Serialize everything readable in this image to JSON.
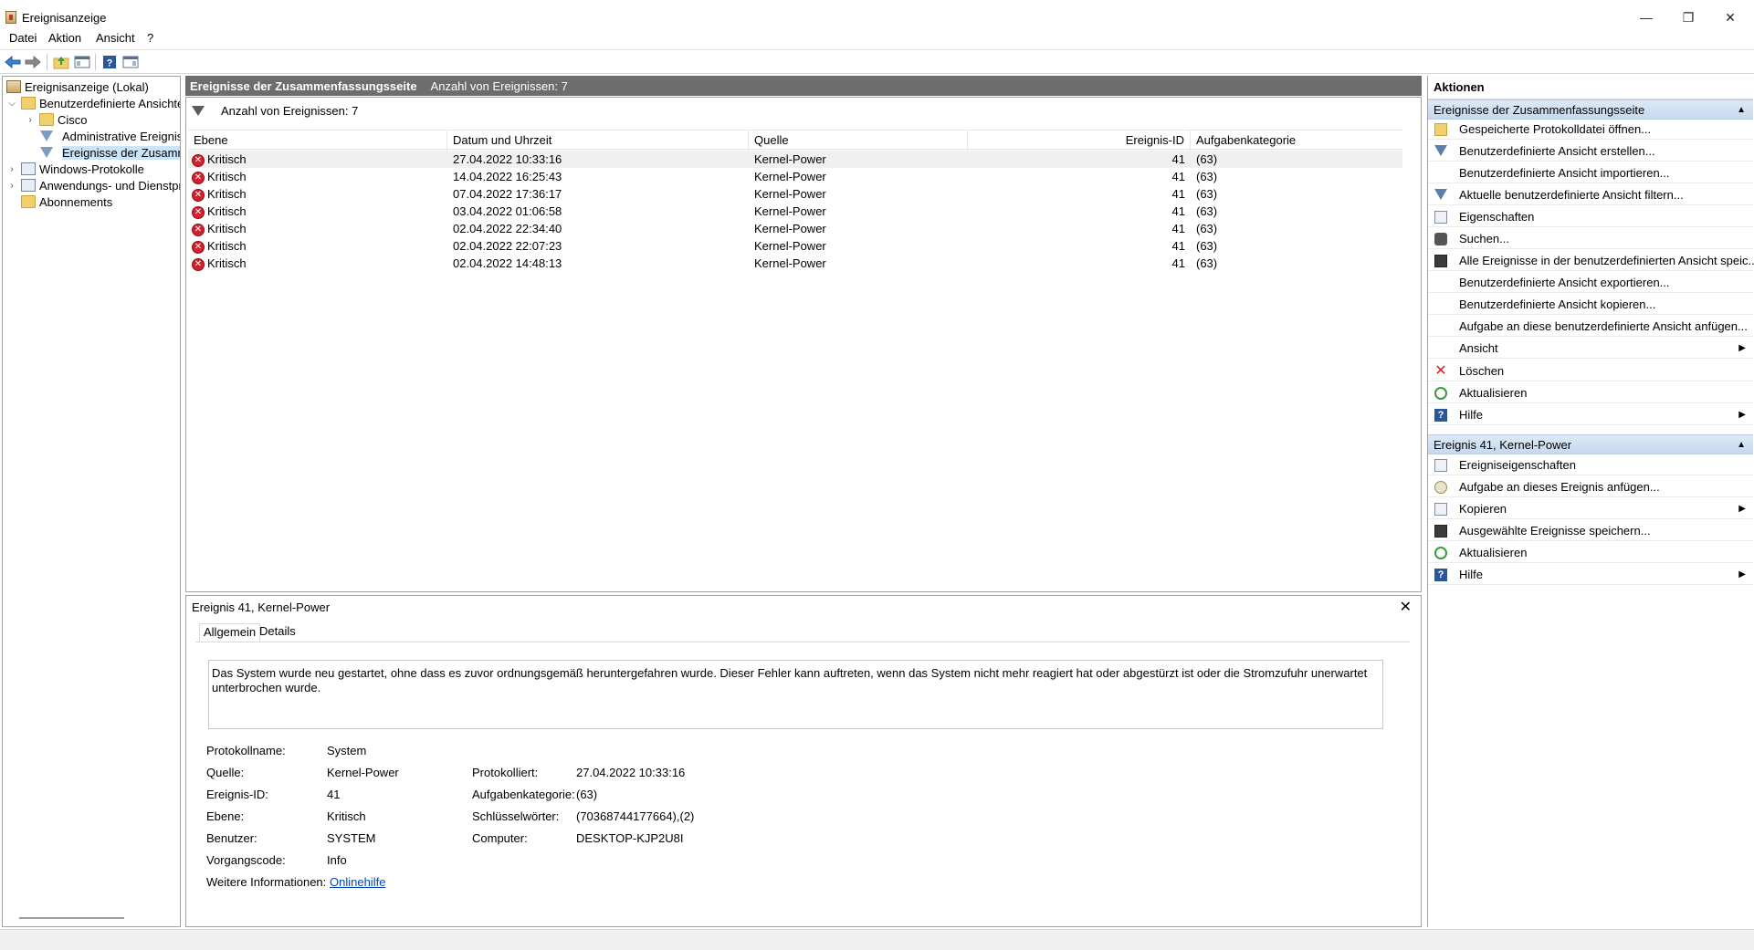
{
  "window": {
    "title": "Ereignisanzeige",
    "minimize": "—",
    "restore": "❐",
    "close": "✕"
  },
  "menu": [
    "Datei",
    "Aktion",
    "Ansicht",
    "?"
  ],
  "tree": {
    "root": "Ereignisanzeige (Lokal)",
    "custom_views": "Benutzerdefinierte Ansichten",
    "cisco": "Cisco",
    "admin_events": "Administrative Ereignisse",
    "summary_events": "Ereignisse der Zusammenfassungsseite",
    "windows_logs": "Windows-Protokolle",
    "app_service_logs": "Anwendungs- und Dienstprotokolle",
    "subscriptions": "Abonnements"
  },
  "center": {
    "header_title": "Ereignisse der Zusammenfassungsseite",
    "header_count": "Anzahl von Ereignissen: 7",
    "filter_count": "Anzahl von Ereignissen: 7",
    "columns": {
      "level": "Ebene",
      "datetime": "Datum und Uhrzeit",
      "source": "Quelle",
      "event_id": "Ereignis-ID",
      "task_category": "Aufgabenkategorie"
    },
    "rows": [
      {
        "level": "Kritisch",
        "datetime": "27.04.2022 10:33:16",
        "source": "Kernel-Power",
        "event_id": "41",
        "task_category": "(63)"
      },
      {
        "level": "Kritisch",
        "datetime": "14.04.2022 16:25:43",
        "source": "Kernel-Power",
        "event_id": "41",
        "task_category": "(63)"
      },
      {
        "level": "Kritisch",
        "datetime": "07.04.2022 17:36:17",
        "source": "Kernel-Power",
        "event_id": "41",
        "task_category": "(63)"
      },
      {
        "level": "Kritisch",
        "datetime": "03.04.2022 01:06:58",
        "source": "Kernel-Power",
        "event_id": "41",
        "task_category": "(63)"
      },
      {
        "level": "Kritisch",
        "datetime": "02.04.2022 22:34:40",
        "source": "Kernel-Power",
        "event_id": "41",
        "task_category": "(63)"
      },
      {
        "level": "Kritisch",
        "datetime": "02.04.2022 22:07:23",
        "source": "Kernel-Power",
        "event_id": "41",
        "task_category": "(63)"
      },
      {
        "level": "Kritisch",
        "datetime": "02.04.2022 14:48:13",
        "source": "Kernel-Power",
        "event_id": "41",
        "task_category": "(63)"
      }
    ]
  },
  "detail": {
    "title": "Ereignis 41, Kernel-Power",
    "close": "✕",
    "tabs": [
      "Allgemein",
      "Details"
    ],
    "description": "Das System wurde neu gestartet, ohne dass es zuvor ordnungsgemäß heruntergefahren wurde. Dieser Fehler kann auftreten, wenn das System nicht mehr reagiert hat oder abgestürzt ist oder die Stromzufuhr unerwartet unterbrochen wurde.",
    "log_name_label": "Protokollname:",
    "log_name": "System",
    "source_label": "Quelle:",
    "source": "Kernel-Power",
    "logged_label": "Protokolliert:",
    "logged": "27.04.2022 10:33:16",
    "event_id_label": "Ereignis-ID:",
    "event_id": "41",
    "task_category_label": "Aufgabenkategorie:",
    "task_category": "(63)",
    "level_label": "Ebene:",
    "level": "Kritisch",
    "keywords_label": "Schlüsselwörter:",
    "keywords": "(70368744177664),(2)",
    "user_label": "Benutzer:",
    "user": "SYSTEM",
    "computer_label": "Computer:",
    "computer": "DESKTOP-KJP2U8I",
    "opcode_label": "Vorgangscode:",
    "opcode": "Info",
    "more_info_label": "Weitere Informationen:",
    "more_info_link": "Onlinehilfe"
  },
  "actions": {
    "title": "Aktionen",
    "section1": "Ereignisse der Zusammenfassungsseite",
    "items1": [
      "Gespeicherte Protokolldatei öffnen...",
      "Benutzerdefinierte Ansicht erstellen...",
      "Benutzerdefinierte Ansicht importieren...",
      "Aktuelle benutzerdefinierte Ansicht filtern...",
      "Eigenschaften",
      "Suchen...",
      "Alle Ereignisse in der benutzerdefinierten Ansicht speic...",
      "Benutzerdefinierte Ansicht exportieren...",
      "Benutzerdefinierte Ansicht kopieren...",
      "Aufgabe an diese benutzerdefinierte Ansicht anfügen...",
      "Ansicht",
      "Löschen",
      "Aktualisieren",
      "Hilfe"
    ],
    "section2": "Ereignis 41, Kernel-Power",
    "items2": [
      "Ereigniseigenschaften",
      "Aufgabe an dieses Ereignis anfügen...",
      "Kopieren",
      "Ausgewählte Ereignisse speichern...",
      "Aktualisieren",
      "Hilfe"
    ]
  },
  "colors": {
    "header_bg": "#6d6d6d",
    "section_bg": "#c6d9ee",
    "critical": "#d2202e",
    "link": "#0645ad"
  }
}
